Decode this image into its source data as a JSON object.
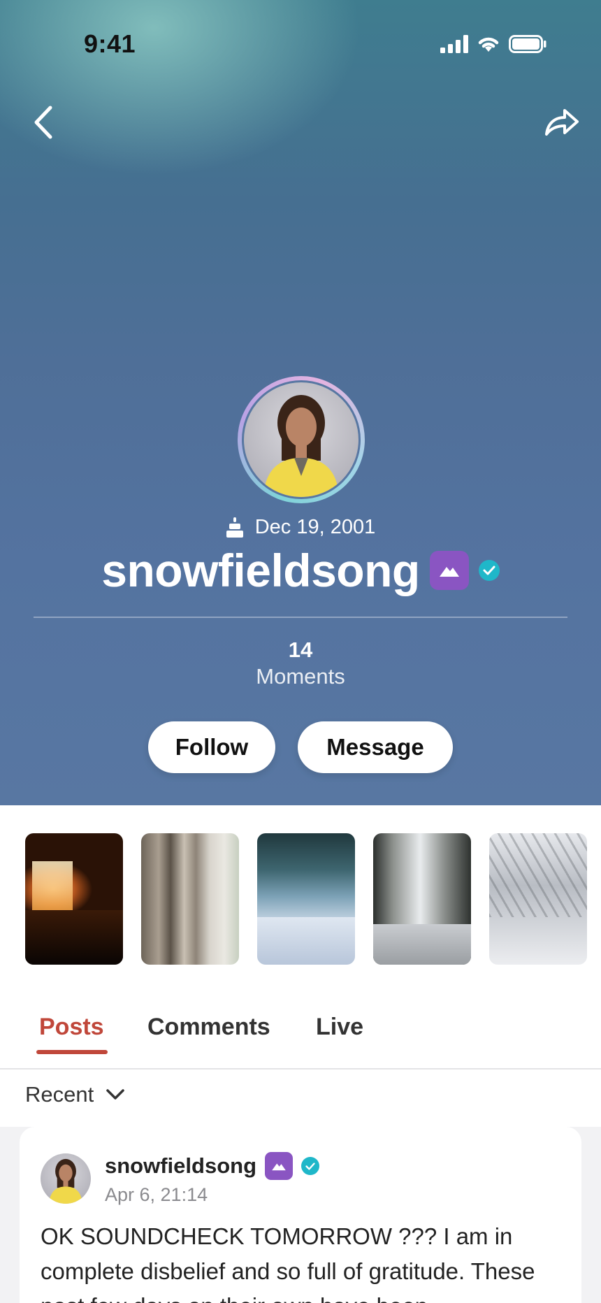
{
  "status_bar": {
    "time": "9:41"
  },
  "profile": {
    "birthday": "Dec 19, 2001",
    "username": "snowfieldsong",
    "stats": {
      "count": "14",
      "label": "Moments"
    },
    "follow_label": "Follow",
    "message_label": "Message"
  },
  "icons": {
    "back": "chevron-left-icon",
    "share": "share-arrow-icon",
    "birthday": "cake-icon",
    "badge": "mountain-badge-icon",
    "verified": "verified-check-icon"
  },
  "tabs": [
    {
      "label": "Posts",
      "active": true
    },
    {
      "label": "Comments",
      "active": false
    },
    {
      "label": "Live",
      "active": false
    }
  ],
  "sort": {
    "label": "Recent"
  },
  "post": {
    "username": "snowfieldsong",
    "date": "Apr 6, 21:14",
    "text": "OK SOUNDCHECK TOMORROW ??? I am in complete disbelief and so full of gratitude. These past few days on their own have been"
  },
  "colors": {
    "accent": "#c0473a",
    "badge_purple": "#8a55c2",
    "verified_teal": "#1fb7c9"
  }
}
